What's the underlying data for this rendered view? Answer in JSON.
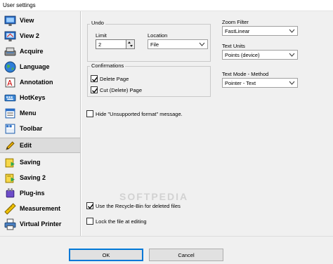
{
  "window": {
    "title": "User settings"
  },
  "sidebar": {
    "selected_index": 9,
    "items": [
      {
        "label": "View",
        "icon": "monitor-view-icon"
      },
      {
        "label": "View 2",
        "icon": "monitor-view2-icon"
      },
      {
        "label": "Acquire",
        "icon": "scanner-icon"
      },
      {
        "label": "Language",
        "icon": "globe-icon"
      },
      {
        "label": "Annotation",
        "icon": "annotation-icon"
      },
      {
        "label": "HotKeys",
        "icon": "keyboard-icon"
      },
      {
        "label": "Menu",
        "icon": "menu-icon"
      },
      {
        "label": "Toolbar",
        "icon": "toolbar-icon"
      },
      {
        "label": "Edit",
        "icon": "pencil-icon"
      },
      {
        "label": "Saving",
        "icon": "save-icon"
      },
      {
        "label": "Saving 2",
        "icon": "save2-icon"
      },
      {
        "label": "Plug-ins",
        "icon": "plugin-icon"
      },
      {
        "label": "Measurement",
        "icon": "ruler-icon"
      },
      {
        "label": "Virtual Printer",
        "icon": "printer-icon"
      }
    ]
  },
  "undo": {
    "group_label": "Undo",
    "limit_label": "Limit",
    "limit_value": "2",
    "location_label": "Location",
    "location_value": "File"
  },
  "confirmations": {
    "group_label": "Confirmations",
    "delete_page": {
      "label": "Delete Page",
      "checked": true
    },
    "cut_page": {
      "label": "Cut (Delete) Page",
      "checked": true
    }
  },
  "hide_unsupported": {
    "label": "Hide \"Unsupported format\" message.",
    "checked": false
  },
  "right": {
    "zoom_filter_label": "Zoom Filter",
    "zoom_filter_value": "FastLinear",
    "text_units_label": "Text Units",
    "text_units_value": "Points (device)",
    "text_mode_label": "Text Mode - Method",
    "text_mode_value": "Pointer - Text"
  },
  "recycle_bin": {
    "label": "Use the Recycle-Bin for deleted files",
    "checked": true
  },
  "lock_file": {
    "label": "Lock the file at editing",
    "checked": false
  },
  "buttons": {
    "ok": "OK",
    "cancel": "Cancel"
  },
  "watermark": "SOFTPEDIA"
}
